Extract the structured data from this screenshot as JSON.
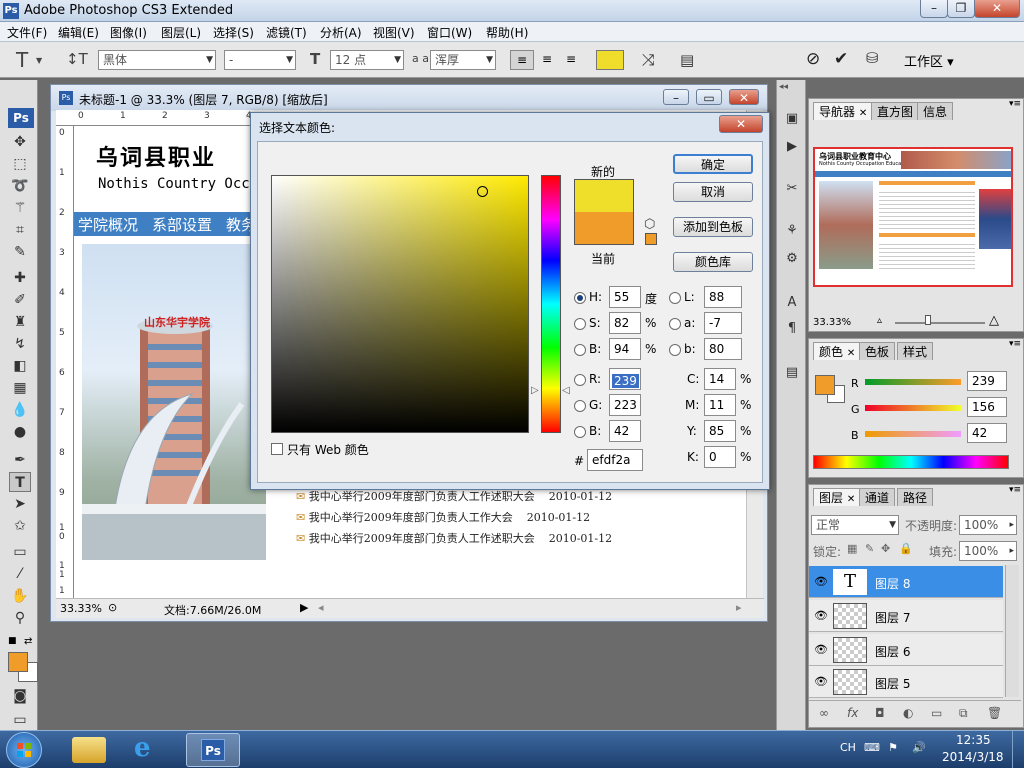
{
  "window": {
    "title": "Adobe Photoshop CS3 Extended",
    "app_logo": "Ps"
  },
  "menu": [
    "文件(F)",
    "编辑(E)",
    "图像(I)",
    "图层(L)",
    "选择(S)",
    "滤镜(T)",
    "分析(A)",
    "视图(V)",
    "窗口(W)",
    "帮助(H)"
  ],
  "options": {
    "font_family": "黑体",
    "font_style": "-",
    "font_size": "12 点",
    "anti_alias_label": "a a",
    "anti_alias": "浑厚",
    "swatch_color": "#f0dc2a",
    "workspace": "工作区 ▾"
  },
  "document": {
    "title": "未标题-1 @ 33.3% (图层 7, RGB/8) [缩放后]",
    "ruler_top": [
      "0",
      "1",
      "2",
      "3",
      "4"
    ],
    "ruler_left": [
      "0",
      "1",
      "2",
      "3",
      "4",
      "5",
      "6",
      "7",
      "8",
      "9",
      "1 0",
      "1 1",
      "1"
    ],
    "heading_cn": "乌词县职业",
    "heading_en": "Nothis Country Occ",
    "nav": [
      "学院概况",
      "系部设置",
      "教务"
    ],
    "building_sign": "山东华宇学院",
    "news": [
      "我中心举行2009年度部门负责人工作述职大会    2010-01-12",
      "我中心举行2009年度部门负责人工作大会    2010-01-12",
      "我中心举行2009年度部门负责人工作述职大会    2010-01-12"
    ],
    "zoom": "33.33%",
    "docsize": "文档:7.66M/26.0M"
  },
  "dialog": {
    "title": "选择文本颜色:",
    "new_label": "新的",
    "current_label": "当前",
    "new_color": "#efdf2a",
    "current_color": "#ef9c2a",
    "ok": "确定",
    "cancel": "取消",
    "add_swatch": "添加到色板",
    "color_lib": "颜色库",
    "web_only": "只有 Web 颜色",
    "H": {
      "label": "H:",
      "value": "55",
      "unit": "度"
    },
    "S": {
      "label": "S:",
      "value": "82",
      "unit": "%"
    },
    "Bv": {
      "label": "B:",
      "value": "94",
      "unit": "%"
    },
    "R": {
      "label": "R:",
      "value": "239"
    },
    "G": {
      "label": "G:",
      "value": "223"
    },
    "Bb": {
      "label": "B:",
      "value": "42"
    },
    "L": {
      "label": "L:",
      "value": "88"
    },
    "a": {
      "label": "a:",
      "value": "-7"
    },
    "b": {
      "label": "b:",
      "value": "80"
    },
    "C": {
      "label": "C:",
      "value": "14",
      "unit": "%"
    },
    "M": {
      "label": "M:",
      "value": "11",
      "unit": "%"
    },
    "Y": {
      "label": "Y:",
      "value": "85",
      "unit": "%"
    },
    "K": {
      "label": "K:",
      "value": "0",
      "unit": "%"
    },
    "hex_label": "#",
    "hex": "efdf2a"
  },
  "navigator": {
    "tabs": [
      "导航器",
      "直方图",
      "信息"
    ],
    "zoom": "33.33%",
    "thumb_title": "乌词县职业教育中心",
    "thumb_sub": "Nothis County Occupation Education Center"
  },
  "color_panel": {
    "tabs": [
      "颜色",
      "色板",
      "样式"
    ],
    "fg_color": "#ef9c2a",
    "R": {
      "label": "R",
      "value": "239"
    },
    "G": {
      "label": "G",
      "value": "156"
    },
    "B": {
      "label": "B",
      "value": "42"
    }
  },
  "layers_panel": {
    "tabs": [
      "图层",
      "通道",
      "路径"
    ],
    "blend": "正常",
    "opacity_label": "不透明度:",
    "opacity": "100%",
    "lock_label": "锁定:",
    "fill_label": "填充:",
    "fill": "100%",
    "layers": [
      "图层 8",
      "图层 7",
      "图层 6",
      "图层 5"
    ]
  },
  "toolbox": {
    "fg_color": "#ef9c2a",
    "bg_color": "#ffffff",
    "logo": "Ps"
  },
  "taskbar": {
    "lang": "CH",
    "time": "12:35",
    "date": "2014/3/18",
    "ps_label": "Ps"
  }
}
